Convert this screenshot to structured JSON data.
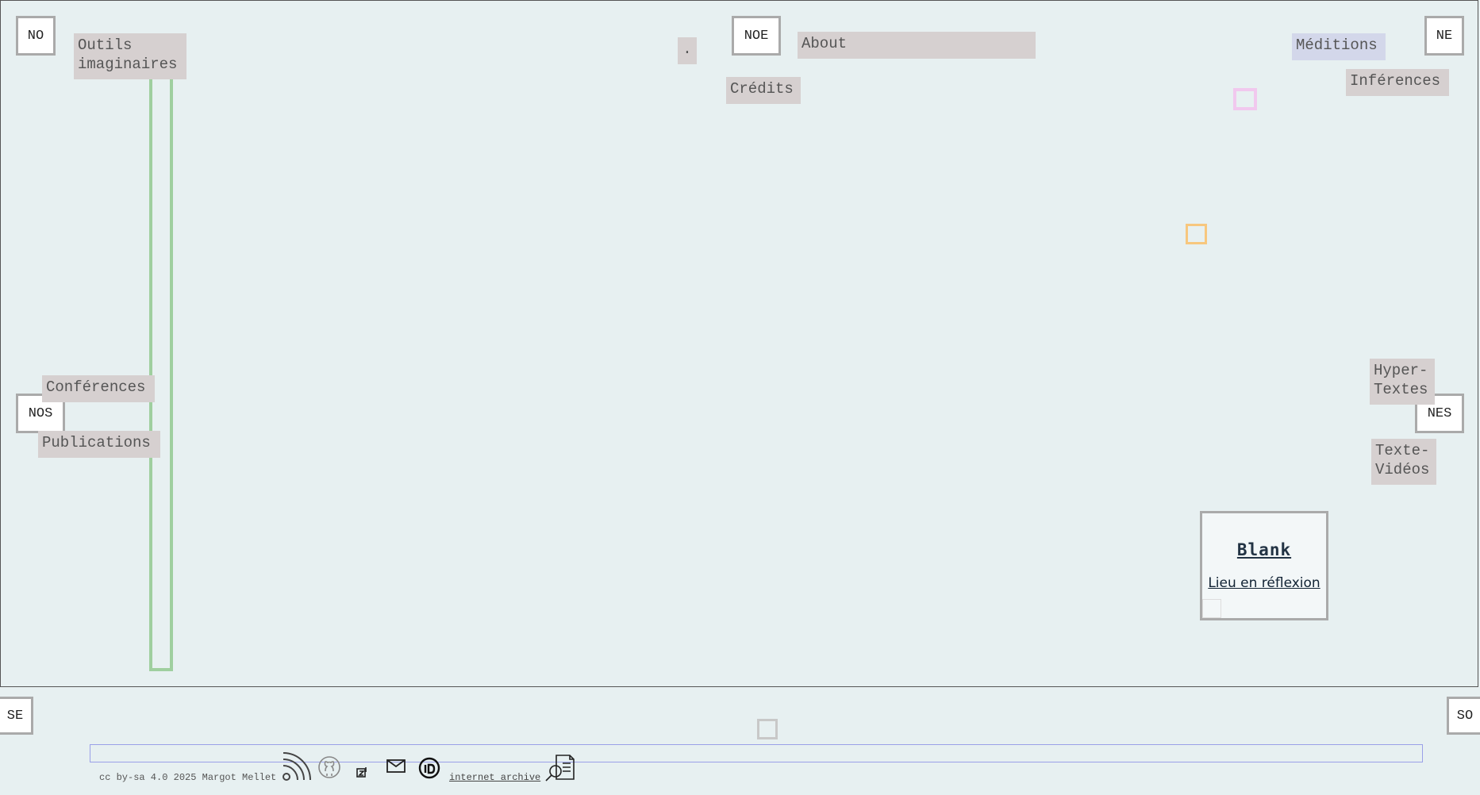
{
  "corners": {
    "no": "NO",
    "noe": "NOE",
    "ne": "NE",
    "nos": "NOS",
    "nes": "NES",
    "se": "SE",
    "so": "SO"
  },
  "menu": {
    "outils_line1": "Outils",
    "outils_line2": "imaginaires",
    "dot": ".",
    "about": "About",
    "credits": "Crédits",
    "meditions": "Méditions",
    "inferences": "Inférences",
    "conferences": "Conférences",
    "publications": "Publications",
    "hyper_line1": "Hyper-",
    "hyper_line2": "Textes",
    "texte_line1": "Texte-",
    "texte_line2": "Vidéos"
  },
  "card": {
    "title": "Blank",
    "subtitle": "Lieu en réflexion"
  },
  "footer": {
    "license": "cc by-sa 4.0 2025 Margot Mellet",
    "archive_link": "internet archive",
    "icons": [
      "rss-icon",
      "github-icon",
      "zotero-icon",
      "mail-icon",
      "orcid-icon",
      "cv-icon"
    ]
  },
  "colors": {
    "background": "#e7f0f1",
    "tag_bg": "#d6d0d0",
    "tag_blue_bg": "#d3d7ea",
    "green_bar": "#9fcf9f",
    "pink_square": "#f1c8ee",
    "orange_square": "#f7c77e",
    "blue_line": "#9aa0e8"
  }
}
